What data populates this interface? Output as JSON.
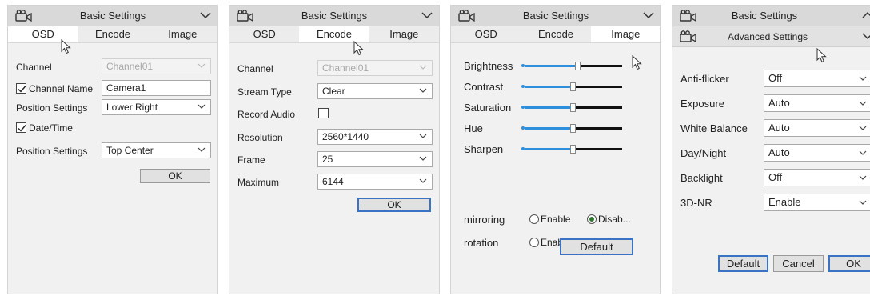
{
  "panel1": {
    "title": "Basic Settings",
    "tabs": [
      "OSD",
      "Encode",
      "Image"
    ],
    "channel_label": "Channel",
    "channel_value": "Channel01",
    "channel_name_label": "Channel Name",
    "channel_name_value": "Camera1",
    "position_settings_label": "Position Settings",
    "position_settings_value": "Lower Right",
    "datetime_label": "Date/Time",
    "position_settings2_label": "Position Settings",
    "position_settings2_value": "Top Center",
    "ok_label": "OK"
  },
  "panel2": {
    "title": "Basic Settings",
    "tabs": [
      "OSD",
      "Encode",
      "Image"
    ],
    "channel_label": "Channel",
    "channel_value": "Channel01",
    "stream_type_label": "Stream Type",
    "stream_type_value": "Clear",
    "record_audio_label": "Record Audio",
    "resolution_label": "Resolution",
    "resolution_value": "2560*1440",
    "frame_label": "Frame",
    "frame_value": "25",
    "maximum_label": "Maximum",
    "maximum_value": "6144",
    "ok_label": "OK"
  },
  "panel3": {
    "title": "Basic Settings",
    "tabs": [
      "OSD",
      "Encode",
      "Image"
    ],
    "sliders": [
      {
        "label": "Brightness",
        "value": 0.55
      },
      {
        "label": "Contrast",
        "value": 0.5
      },
      {
        "label": "Saturation",
        "value": 0.5
      },
      {
        "label": "Hue",
        "value": 0.5
      },
      {
        "label": "Sharpen",
        "value": 0.5
      }
    ],
    "mirroring_label": "mirroring",
    "rotation_label": "rotation",
    "enable_label": "Enable",
    "disable_label": "Disab...",
    "default_label": "Default"
  },
  "panel4": {
    "title": "Basic Settings",
    "subtitle": "Advanced Settings",
    "anti_flicker_label": "Anti-flicker",
    "anti_flicker_value": "Off",
    "exposure_label": "Exposure",
    "exposure_value": "Auto",
    "white_balance_label": "White Balance",
    "white_balance_value": "Auto",
    "day_night_label": "Day/Night",
    "day_night_value": "Auto",
    "backlight_label": "Backlight",
    "backlight_value": "Off",
    "nr_label": "3D-NR",
    "nr_value": "Enable",
    "default_label": "Default",
    "cancel_label": "Cancel",
    "ok_label": "OK"
  },
  "icons": {
    "camera": "camera-icon",
    "chevron_down": "chevron-down-icon",
    "chevron_up": "chevron-up-icon",
    "dropdown_arrow": "dropdown-arrow-icon",
    "checkmark": "checkmark-icon",
    "cursor": "mouse-cursor-icon"
  },
  "colors": {
    "slider_accent": "#2e8fdc",
    "focus_border": "#3a73c4",
    "radio_selected": "#2b7a2b"
  }
}
